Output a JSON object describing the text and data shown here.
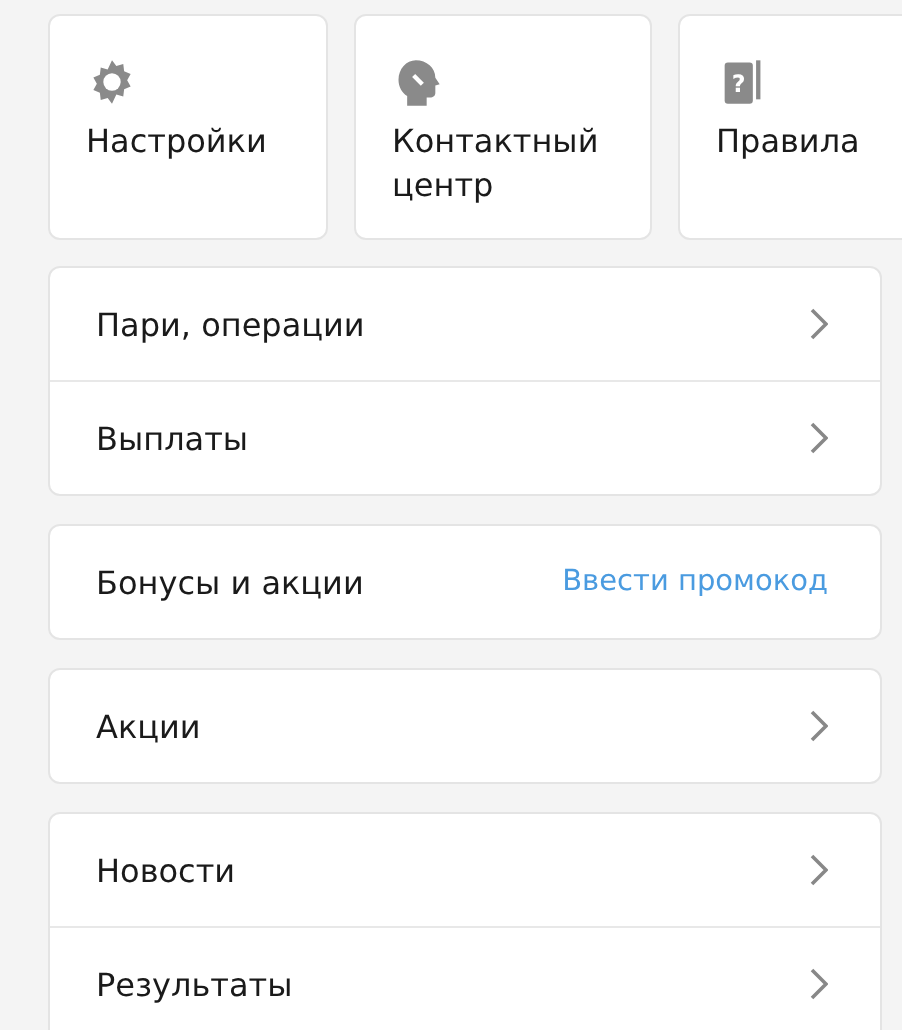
{
  "tiles": [
    {
      "kind": "gear",
      "label": "Настройки"
    },
    {
      "kind": "head",
      "label": "Контактный центр"
    },
    {
      "kind": "book",
      "label": "Правила",
      "icon_mark": "?"
    }
  ],
  "groups": [
    {
      "items": [
        {
          "kind": "link",
          "label": "Пари, операции"
        },
        {
          "kind": "link",
          "label": "Выплаты"
        }
      ]
    },
    {
      "items": [
        {
          "kind": "action",
          "label": "Бонусы и акции",
          "action": "Ввести промокод"
        }
      ]
    },
    {
      "items": [
        {
          "kind": "link",
          "label": "Акции"
        }
      ]
    },
    {
      "items": [
        {
          "kind": "link",
          "label": "Новости"
        },
        {
          "kind": "link",
          "label": "Результаты"
        }
      ]
    }
  ]
}
